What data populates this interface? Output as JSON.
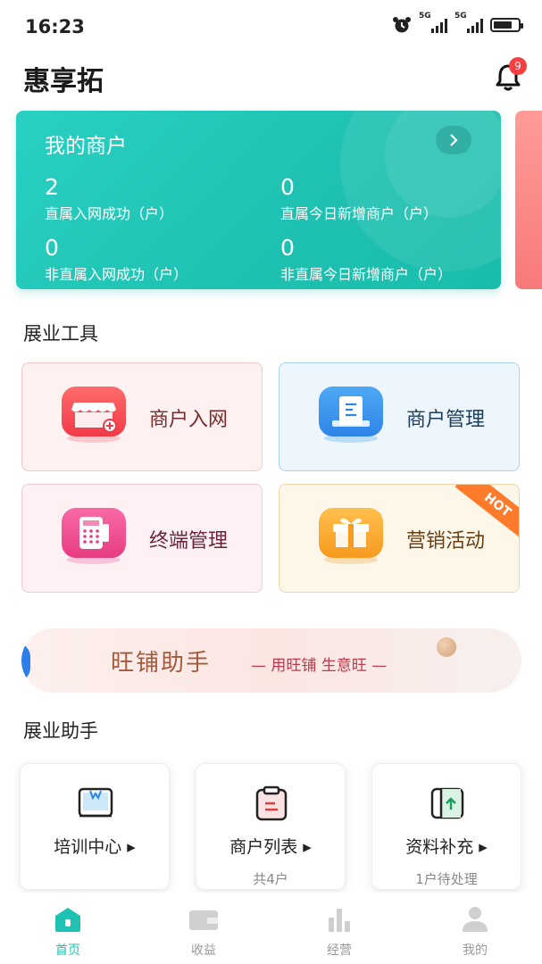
{
  "status_bar": {
    "time": "16:23",
    "network1": "5G",
    "network2": "5G"
  },
  "header": {
    "app_title": "惠享拓",
    "notification_count": "9"
  },
  "merchant_card": {
    "title": "我的商户",
    "stats": [
      {
        "value": "2",
        "label": "直属入网成功（户）"
      },
      {
        "value": "0",
        "label": "直属今日新增商户（户）"
      },
      {
        "value": "0",
        "label": "非直属入网成功（户）"
      },
      {
        "value": "0",
        "label": "非直属今日新增商户（户）"
      }
    ]
  },
  "tools": {
    "title": "展业工具",
    "items": [
      {
        "label": "商户入网",
        "icon": "storefront-icon",
        "color": "#7a2b2b"
      },
      {
        "label": "商户管理",
        "icon": "document-icon",
        "color": "#1c3e5e"
      },
      {
        "label": "终端管理",
        "icon": "pos-terminal-icon",
        "color": "#6b2236"
      },
      {
        "label": "营销活动",
        "icon": "gift-icon",
        "color": "#6b3d12",
        "badge": "HOT"
      }
    ]
  },
  "banner": {
    "main": "旺铺助手",
    "sub": "— 用旺铺  生意旺 —"
  },
  "assistant": {
    "title": "展业助手",
    "items": [
      {
        "label": "培训中心 ▸",
        "sub": "",
        "icon": "book-icon"
      },
      {
        "label": "商户列表 ▸",
        "sub": "共4户",
        "icon": "clipboard-icon"
      },
      {
        "label": "资料补充 ▸",
        "sub": "1户待处理",
        "icon": "upload-doc-icon"
      }
    ]
  },
  "tab_bar": {
    "items": [
      {
        "label": "首页",
        "icon": "home-icon",
        "active": true
      },
      {
        "label": "收益",
        "icon": "wallet-icon",
        "active": false
      },
      {
        "label": "经营",
        "icon": "bar-chart-icon",
        "active": false
      },
      {
        "label": "我的",
        "icon": "user-icon",
        "active": false
      }
    ]
  },
  "colors": {
    "accent": "#1fc2b2",
    "hot": "#ff7a2a",
    "badge": "#f44040"
  }
}
